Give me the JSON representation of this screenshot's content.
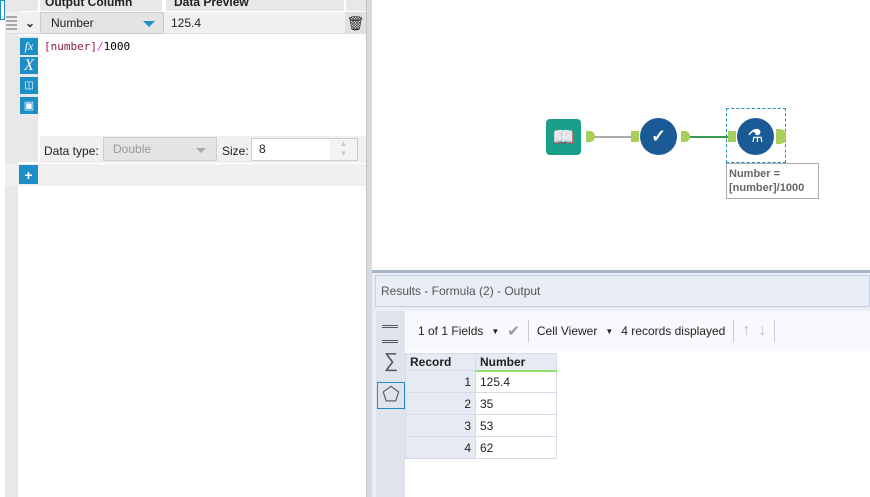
{
  "formula_panel": {
    "headers": {
      "output_column": "Output Column",
      "data_preview": "Data Preview"
    },
    "row": {
      "output_column": "Number",
      "data_preview": "125.4",
      "expression_field": "[number]",
      "expression_op": "/",
      "expression_value": "1000"
    },
    "data_type_label": "Data type:",
    "data_type_value": "Double",
    "size_label": "Size:",
    "size_value": "8",
    "add_label": "+"
  },
  "canvas": {
    "annotation_line1": "Number =",
    "annotation_line2": "[number]/1000"
  },
  "results": {
    "title": "Results - Formula (2) - Output",
    "fields_label": "1 of 1 Fields",
    "cell_viewer_label": "Cell Viewer",
    "records_label": "4 records displayed",
    "columns": [
      "Record",
      "Number"
    ],
    "rows": [
      {
        "record": "1",
        "number": "125.4"
      },
      {
        "record": "2",
        "number": "35"
      },
      {
        "record": "3",
        "number": "53"
      },
      {
        "record": "4",
        "number": "62"
      }
    ]
  },
  "colors": {
    "accent": "#1e8fc6",
    "tool_blue": "#1a5a96",
    "input_green": "#1aa08a",
    "anchor": "#a9cf5a"
  }
}
